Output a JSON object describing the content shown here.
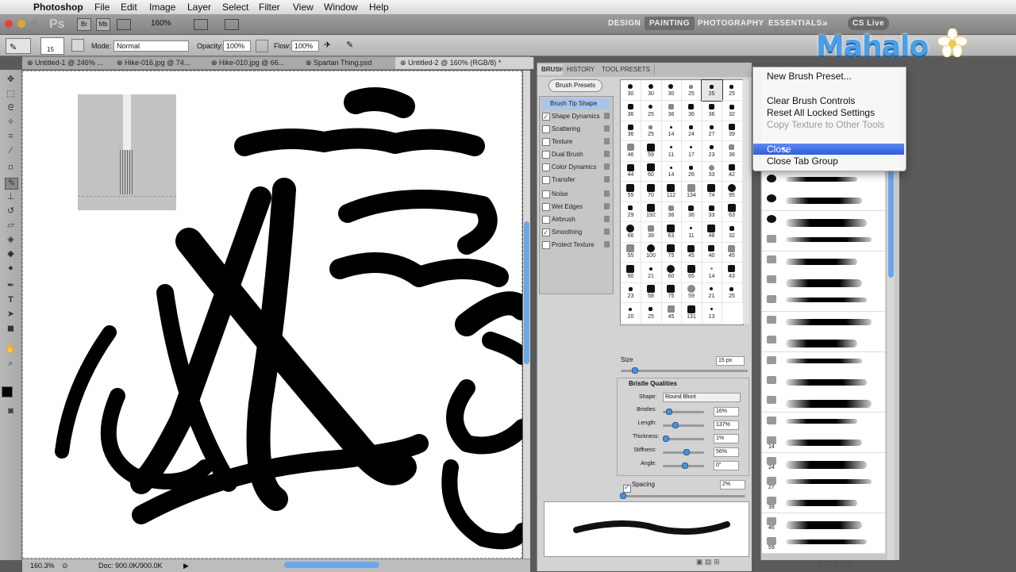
{
  "menubar": {
    "apple": "",
    "app": "Photoshop",
    "items": [
      "File",
      "Edit",
      "Image",
      "Layer",
      "Select",
      "Filter",
      "View",
      "Window",
      "Help"
    ]
  },
  "appbar": {
    "ps_logo": "Ps",
    "br": "Br",
    "mb": "Mb",
    "zoom": "160%",
    "workspaces": [
      "DESIGN",
      "PAINTING",
      "PHOTOGRAPHY",
      "ESSENTIALS"
    ],
    "more": "»",
    "cslive": "CS Live"
  },
  "options": {
    "brush_size": "15",
    "mode_label": "Mode:",
    "mode_value": "Normal",
    "opacity_label": "Opacity:",
    "opacity_value": "100%",
    "flow_label": "Flow:",
    "flow_value": "100%"
  },
  "tabs": [
    {
      "label": "Untitled-1 @ 246% ..."
    },
    {
      "label": "Hike-016.jpg @ 74..."
    },
    {
      "label": "Hike-010.jpg @ 66..."
    },
    {
      "label": "Spartan Thing.psd"
    },
    {
      "label": "Untitled-2 @ 160% (RGB/8) *"
    }
  ],
  "status": {
    "zoom": "160.3%",
    "doc": "Doc: 900.0K/900.0K"
  },
  "brush_panel": {
    "tabs": [
      "BRUSH",
      "HISTORY",
      "TOOL PRESETS"
    ],
    "presets_button": "Brush Presets",
    "options": [
      {
        "label": "Brush Tip Shape",
        "checked": null
      },
      {
        "label": "Shape Dynamics",
        "checked": true
      },
      {
        "label": "Scattering",
        "checked": false
      },
      {
        "label": "Texture",
        "checked": false
      },
      {
        "label": "Dual Brush",
        "checked": false
      },
      {
        "label": "Color Dynamics",
        "checked": false
      },
      {
        "label": "Transfer",
        "checked": false
      },
      {
        "label": "Noise",
        "checked": false
      },
      {
        "label": "Wet Edges",
        "checked": false
      },
      {
        "label": "Airbrush",
        "checked": false
      },
      {
        "label": "Smoothing",
        "checked": true
      },
      {
        "label": "Protect Texture",
        "checked": false
      }
    ],
    "tip_sizes": [
      "30",
      "30",
      "30",
      "25",
      "25",
      "25",
      "36",
      "25",
      "36",
      "36",
      "36",
      "32",
      "36",
      "25",
      "14",
      "24",
      "27",
      "39",
      "46",
      "59",
      "11",
      "17",
      "23",
      "36",
      "44",
      "60",
      "14",
      "26",
      "33",
      "42",
      "55",
      "70",
      "112",
      "134",
      "74",
      "95",
      "29",
      "192",
      "36",
      "36",
      "33",
      "63",
      "66",
      "39",
      "63",
      "11",
      "48",
      "32",
      "55",
      "100",
      "75",
      "45",
      "40",
      "45",
      "90",
      "21",
      "60",
      "65",
      "14",
      "43",
      "23",
      "58",
      "75",
      "59",
      "21",
      "25",
      "20",
      "25",
      "45",
      "131",
      "13"
    ],
    "size_label": "Size",
    "size_value": "15 px",
    "bristle_title": "Bristle Qualities",
    "shape_label": "Shape:",
    "shape_value": "Round Blunt",
    "bristles": [
      {
        "label": "Bristles:",
        "value": "16%"
      },
      {
        "label": "Length:",
        "value": "137%"
      },
      {
        "label": "Thickness:",
        "value": "1%"
      },
      {
        "label": "Stiffness:",
        "value": "56%"
      },
      {
        "label": "Angle:",
        "value": "0°"
      }
    ],
    "spacing_label": "Spacing",
    "spacing_value": "2%"
  },
  "preset_list_numbers": [
    "14",
    "24",
    "27",
    "39",
    "46",
    "59"
  ],
  "menu": {
    "items": [
      {
        "label": "New Brush Preset...",
        "state": "normal"
      },
      {
        "label": "Clear Brush Controls",
        "state": "normal"
      },
      {
        "label": "Reset All Locked Settings",
        "state": "normal"
      },
      {
        "label": "Copy Texture to Other Tools",
        "state": "disabled"
      },
      {
        "label": "Close",
        "state": "highlighted"
      },
      {
        "label": "Close Tab Group",
        "state": "normal"
      }
    ]
  },
  "watermark": "Mahalo"
}
